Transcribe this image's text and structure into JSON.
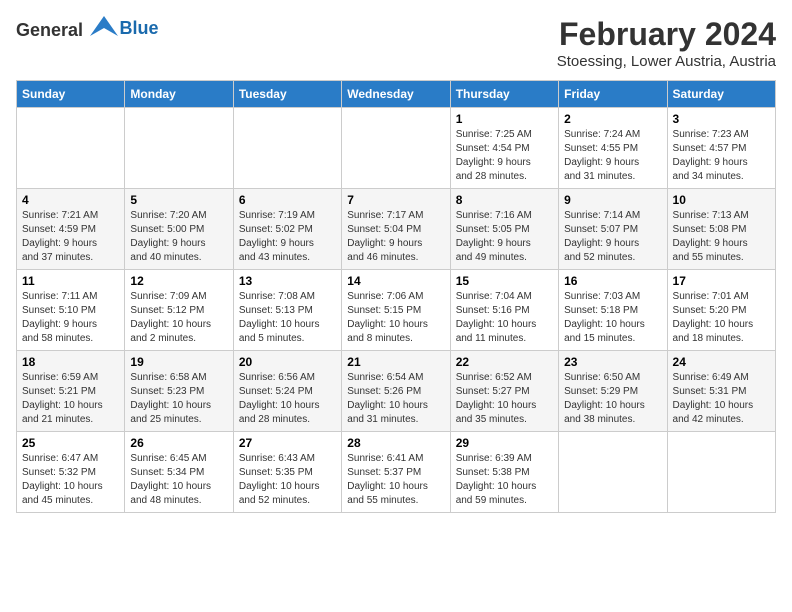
{
  "header": {
    "logo_general": "General",
    "logo_blue": "Blue",
    "title": "February 2024",
    "subtitle": "Stoessing, Lower Austria, Austria"
  },
  "calendar": {
    "days_of_week": [
      "Sunday",
      "Monday",
      "Tuesday",
      "Wednesday",
      "Thursday",
      "Friday",
      "Saturday"
    ],
    "weeks": [
      [
        {
          "day": "",
          "info": ""
        },
        {
          "day": "",
          "info": ""
        },
        {
          "day": "",
          "info": ""
        },
        {
          "day": "",
          "info": ""
        },
        {
          "day": "1",
          "info": "Sunrise: 7:25 AM\nSunset: 4:54 PM\nDaylight: 9 hours\nand 28 minutes."
        },
        {
          "day": "2",
          "info": "Sunrise: 7:24 AM\nSunset: 4:55 PM\nDaylight: 9 hours\nand 31 minutes."
        },
        {
          "day": "3",
          "info": "Sunrise: 7:23 AM\nSunset: 4:57 PM\nDaylight: 9 hours\nand 34 minutes."
        }
      ],
      [
        {
          "day": "4",
          "info": "Sunrise: 7:21 AM\nSunset: 4:59 PM\nDaylight: 9 hours\nand 37 minutes."
        },
        {
          "day": "5",
          "info": "Sunrise: 7:20 AM\nSunset: 5:00 PM\nDaylight: 9 hours\nand 40 minutes."
        },
        {
          "day": "6",
          "info": "Sunrise: 7:19 AM\nSunset: 5:02 PM\nDaylight: 9 hours\nand 43 minutes."
        },
        {
          "day": "7",
          "info": "Sunrise: 7:17 AM\nSunset: 5:04 PM\nDaylight: 9 hours\nand 46 minutes."
        },
        {
          "day": "8",
          "info": "Sunrise: 7:16 AM\nSunset: 5:05 PM\nDaylight: 9 hours\nand 49 minutes."
        },
        {
          "day": "9",
          "info": "Sunrise: 7:14 AM\nSunset: 5:07 PM\nDaylight: 9 hours\nand 52 minutes."
        },
        {
          "day": "10",
          "info": "Sunrise: 7:13 AM\nSunset: 5:08 PM\nDaylight: 9 hours\nand 55 minutes."
        }
      ],
      [
        {
          "day": "11",
          "info": "Sunrise: 7:11 AM\nSunset: 5:10 PM\nDaylight: 9 hours\nand 58 minutes."
        },
        {
          "day": "12",
          "info": "Sunrise: 7:09 AM\nSunset: 5:12 PM\nDaylight: 10 hours\nand 2 minutes."
        },
        {
          "day": "13",
          "info": "Sunrise: 7:08 AM\nSunset: 5:13 PM\nDaylight: 10 hours\nand 5 minutes."
        },
        {
          "day": "14",
          "info": "Sunrise: 7:06 AM\nSunset: 5:15 PM\nDaylight: 10 hours\nand 8 minutes."
        },
        {
          "day": "15",
          "info": "Sunrise: 7:04 AM\nSunset: 5:16 PM\nDaylight: 10 hours\nand 11 minutes."
        },
        {
          "day": "16",
          "info": "Sunrise: 7:03 AM\nSunset: 5:18 PM\nDaylight: 10 hours\nand 15 minutes."
        },
        {
          "day": "17",
          "info": "Sunrise: 7:01 AM\nSunset: 5:20 PM\nDaylight: 10 hours\nand 18 minutes."
        }
      ],
      [
        {
          "day": "18",
          "info": "Sunrise: 6:59 AM\nSunset: 5:21 PM\nDaylight: 10 hours\nand 21 minutes."
        },
        {
          "day": "19",
          "info": "Sunrise: 6:58 AM\nSunset: 5:23 PM\nDaylight: 10 hours\nand 25 minutes."
        },
        {
          "day": "20",
          "info": "Sunrise: 6:56 AM\nSunset: 5:24 PM\nDaylight: 10 hours\nand 28 minutes."
        },
        {
          "day": "21",
          "info": "Sunrise: 6:54 AM\nSunset: 5:26 PM\nDaylight: 10 hours\nand 31 minutes."
        },
        {
          "day": "22",
          "info": "Sunrise: 6:52 AM\nSunset: 5:27 PM\nDaylight: 10 hours\nand 35 minutes."
        },
        {
          "day": "23",
          "info": "Sunrise: 6:50 AM\nSunset: 5:29 PM\nDaylight: 10 hours\nand 38 minutes."
        },
        {
          "day": "24",
          "info": "Sunrise: 6:49 AM\nSunset: 5:31 PM\nDaylight: 10 hours\nand 42 minutes."
        }
      ],
      [
        {
          "day": "25",
          "info": "Sunrise: 6:47 AM\nSunset: 5:32 PM\nDaylight: 10 hours\nand 45 minutes."
        },
        {
          "day": "26",
          "info": "Sunrise: 6:45 AM\nSunset: 5:34 PM\nDaylight: 10 hours\nand 48 minutes."
        },
        {
          "day": "27",
          "info": "Sunrise: 6:43 AM\nSunset: 5:35 PM\nDaylight: 10 hours\nand 52 minutes."
        },
        {
          "day": "28",
          "info": "Sunrise: 6:41 AM\nSunset: 5:37 PM\nDaylight: 10 hours\nand 55 minutes."
        },
        {
          "day": "29",
          "info": "Sunrise: 6:39 AM\nSunset: 5:38 PM\nDaylight: 10 hours\nand 59 minutes."
        },
        {
          "day": "",
          "info": ""
        },
        {
          "day": "",
          "info": ""
        }
      ]
    ]
  }
}
